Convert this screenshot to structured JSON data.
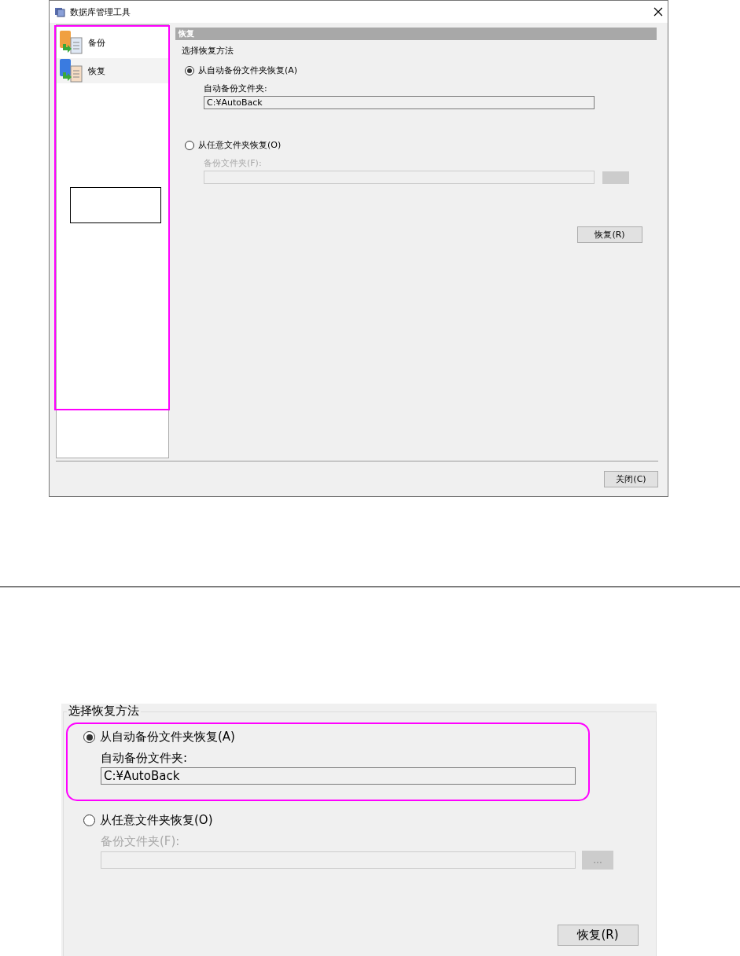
{
  "dialog": {
    "title": "数据库管理工具",
    "sidebar": {
      "items": [
        {
          "label": "备份",
          "selected": false
        },
        {
          "label": "恢复",
          "selected": true
        }
      ]
    },
    "panel": {
      "header": "恢复",
      "group_title": "选择恢复方法",
      "options": [
        {
          "label": "从自动备份文件夹恢复(A)",
          "selected": true,
          "disabled": false,
          "field_label": "自动备份文件夹:",
          "value": "C:¥AutoBack"
        },
        {
          "label": "从任意文件夹恢复(O)",
          "selected": false,
          "disabled": true,
          "field_label": "备份文件夹(F):",
          "browse_button": true
        }
      ],
      "restore_button": "恢复(R)"
    },
    "close_button": "关闭(C)"
  },
  "detail": {
    "group_title": "选择恢复方法",
    "options": [
      {
        "label": "从自动备份文件夹恢复(A)",
        "selected": true,
        "disabled": false,
        "field_label": "自动备份文件夹:",
        "value": "C:¥AutoBack"
      },
      {
        "label": "从任意文件夹恢复(O)",
        "selected": false,
        "disabled": true,
        "field_label": "备份文件夹(F):",
        "browse": "..."
      }
    ],
    "restore_button": "恢复(R)"
  }
}
